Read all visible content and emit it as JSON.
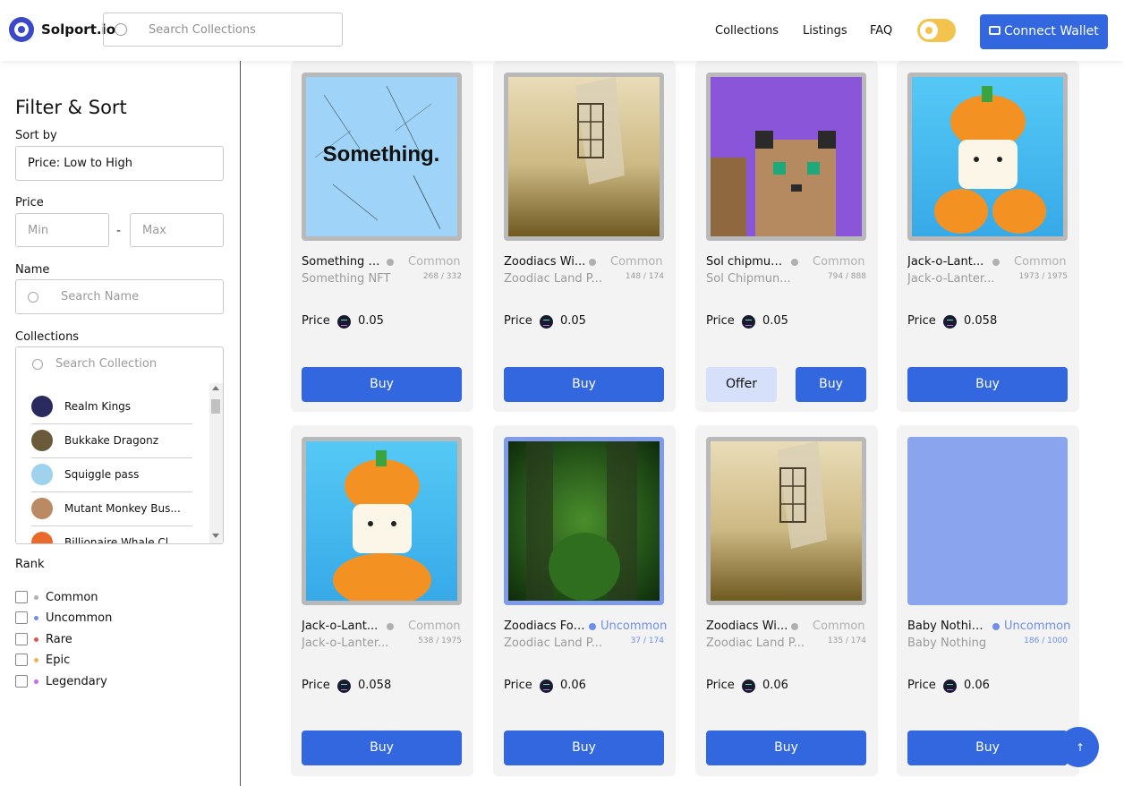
{
  "header": {
    "brand": "Solport.io",
    "search_placeholder": "Search Collections",
    "nav": [
      "Collections",
      "Listings",
      "FAQ"
    ],
    "wallet_label": "Connect Wallet"
  },
  "sidebar": {
    "title": "Filter & Sort",
    "sort_label": "Sort by",
    "sort_value": "Price: Low to High",
    "price_label": "Price",
    "price_min_placeholder": "Min",
    "price_max_placeholder": "Max",
    "price_separator": "-",
    "name_label": "Name",
    "name_placeholder": "Search Name",
    "collections_label": "Collections",
    "collection_search_placeholder": "Search Collection",
    "collections": [
      {
        "name": "Realm Kings",
        "color": "#2b2a5e"
      },
      {
        "name": "Bukkake Dragonz",
        "color": "#6b5a3a"
      },
      {
        "name": "Squiggle pass",
        "color": "#9fd2ec"
      },
      {
        "name": "Mutant Monkey Bus...",
        "color": "#b98a64"
      },
      {
        "name": "Billionaire Whale Cl...",
        "color": "#e96a2a"
      }
    ],
    "rank_label": "Rank",
    "ranks": [
      {
        "name": "Common",
        "color": "#b0b0b0"
      },
      {
        "name": "Uncommon",
        "color": "#6e8fe9"
      },
      {
        "name": "Rare",
        "color": "#e3564e"
      },
      {
        "name": "Epic",
        "color": "#f2b44d"
      },
      {
        "name": "Legendary",
        "color": "#c76be0"
      }
    ]
  },
  "listings": [
    {
      "name": "Something N...",
      "rank": "Common",
      "collection": "Something NFT",
      "count": "268 / 332",
      "price": "0.05",
      "offer": false,
      "image": "something"
    },
    {
      "name": "Zoodiacs Wi...",
      "rank": "Common",
      "collection": "Zoodiac Land P...",
      "count": "148 / 174",
      "price": "0.05",
      "offer": false,
      "image": "windmill"
    },
    {
      "name": "Sol chipmun...",
      "rank": "Common",
      "collection": "Sol Chipmun...",
      "count": "794 / 888",
      "price": "0.05",
      "offer": true,
      "image": "chipmunk"
    },
    {
      "name": "Jack-o-Lant...",
      "rank": "Common",
      "collection": "Jack-o-Lanter...",
      "count": "1973 / 1975",
      "price": "0.058",
      "offer": false,
      "image": "pumpkin"
    },
    {
      "name": "Jack-o-Lant...",
      "rank": "Common",
      "collection": "Jack-o-Lanter...",
      "count": "538 / 1975",
      "price": "0.058",
      "offer": false,
      "image": "pumpkin"
    },
    {
      "name": "Zoodiacs For...",
      "rank": "Uncommon",
      "collection": "Zoodiac Land P...",
      "count": "37 / 174",
      "price": "0.06",
      "offer": false,
      "image": "forest"
    },
    {
      "name": "Zoodiacs Wi...",
      "rank": "Common",
      "collection": "Zoodiac Land P...",
      "count": "135 / 174",
      "price": "0.06",
      "offer": false,
      "image": "windmill"
    },
    {
      "name": "Baby Nothin...",
      "rank": "Uncommon",
      "collection": "Baby Nothing",
      "count": "186 / 1000",
      "price": "0.06",
      "offer": false,
      "image": "blank"
    }
  ],
  "labels": {
    "price": "Price",
    "buy": "Buy",
    "offer": "Offer",
    "back_to_top": "↑"
  },
  "colors": {
    "accent": "#3367e0",
    "common": "#b0b0b0",
    "uncommon": "#6e8fe9"
  }
}
